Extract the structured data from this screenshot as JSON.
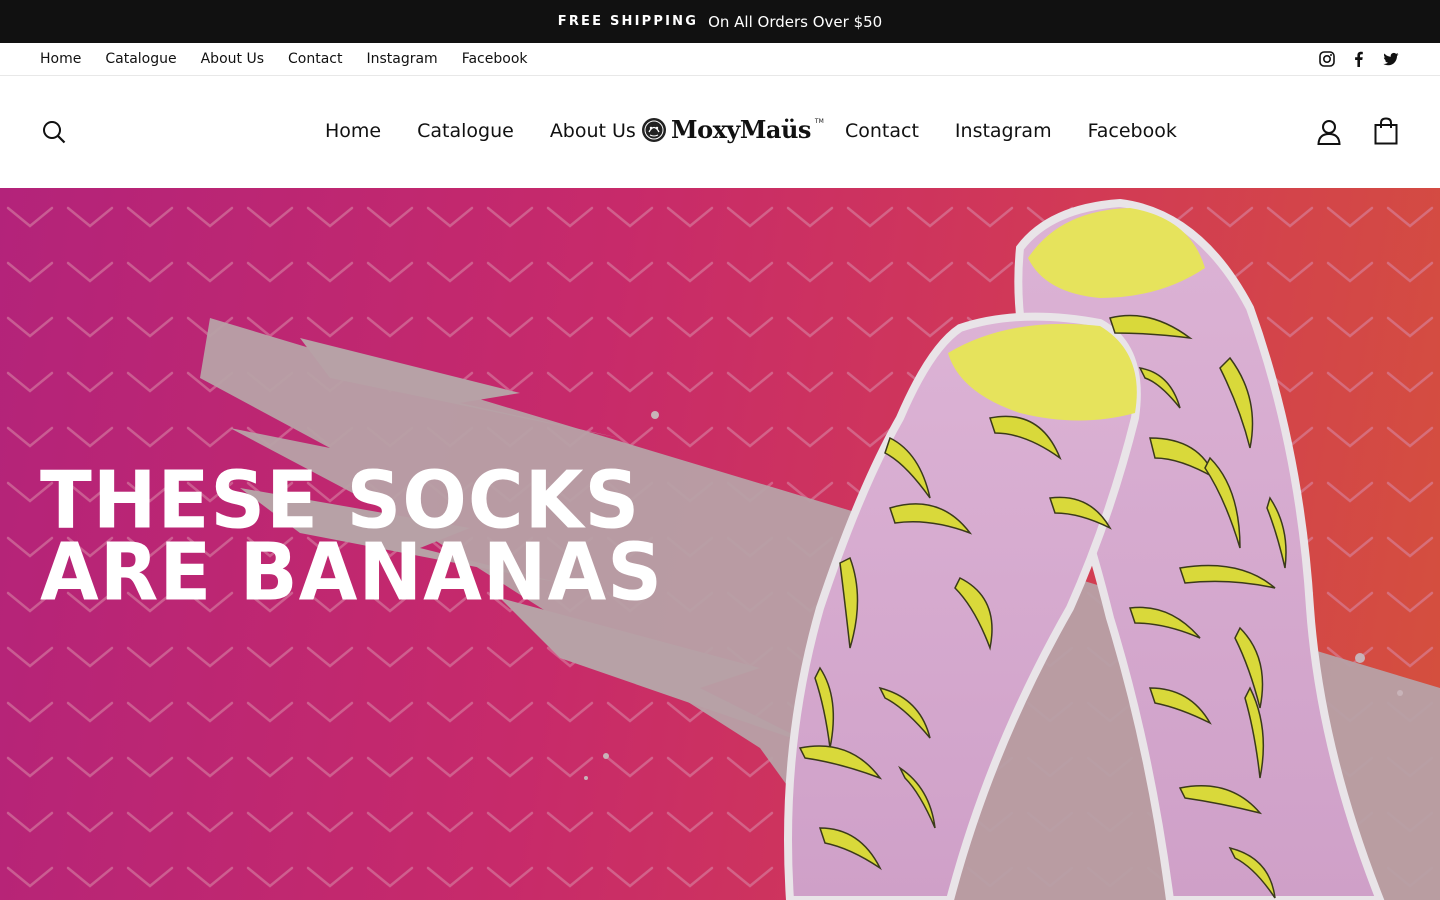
{
  "announcement": {
    "bold": "FREE SHIPPING",
    "text": "On All Orders Over $50"
  },
  "topbar": {
    "links": [
      "Home",
      "Catalogue",
      "About Us",
      "Contact",
      "Instagram",
      "Facebook"
    ],
    "social": [
      "instagram-icon",
      "facebook-icon",
      "twitter-icon"
    ]
  },
  "header": {
    "nav_left": [
      "Home",
      "Catalogue",
      "About Us"
    ],
    "nav_right": [
      "Contact",
      "Instagram",
      "Facebook"
    ],
    "logo": "MoxyMaüs",
    "logo_tm": "TM"
  },
  "hero": {
    "line1": "THESE SOCKS",
    "line2": "ARE BANANAS"
  },
  "colors": {
    "announce_bg": "#111111",
    "hero_magenta": "#b3237a",
    "hero_orange": "#d4513c",
    "sock_pink": "#d6a9cf",
    "banana_yellow": "#e4e04a"
  }
}
